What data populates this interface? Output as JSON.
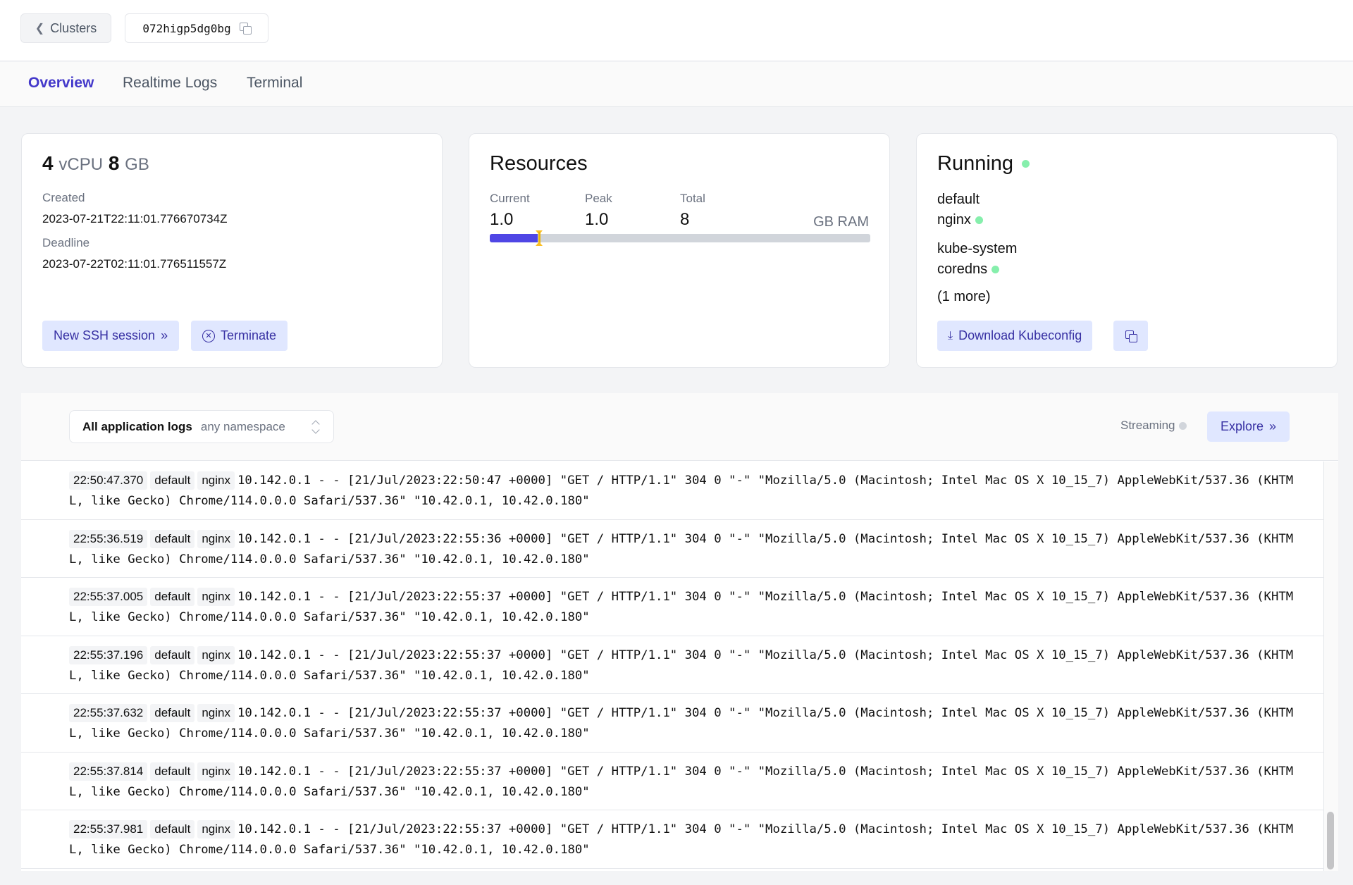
{
  "header": {
    "back_label": "Clusters",
    "cluster_id": "072higp5dg0bg"
  },
  "tabs": [
    {
      "label": "Overview",
      "active": true
    },
    {
      "label": "Realtime Logs",
      "active": false
    },
    {
      "label": "Terminal",
      "active": false
    }
  ],
  "specs_card": {
    "vcpu": "4",
    "vcpu_unit": "vCPU",
    "memory": "8",
    "memory_unit": "GB",
    "created_label": "Created",
    "created_value": "2023-07-21T22:11:01.776670734Z",
    "deadline_label": "Deadline",
    "deadline_value": "2023-07-22T02:11:01.776511557Z",
    "ssh_button": "New SSH session",
    "terminate_button": "Terminate"
  },
  "resources_card": {
    "title": "Resources",
    "current_label": "Current",
    "current_value": "1.0",
    "peak_label": "Peak",
    "peak_value": "1.0",
    "total_label": "Total",
    "total_value": "8",
    "unit": "GB RAM",
    "current_fraction": 0.125,
    "peak_fraction": 0.125,
    "fill_color": "#4f46e5",
    "peak_color": "#fbbf24"
  },
  "status_card": {
    "status": "Running",
    "status_color": "#86efac",
    "namespaces": [
      {
        "name": "default",
        "service": "nginx"
      },
      {
        "name": "kube-system",
        "service": "coredns"
      }
    ],
    "more_label": "(1 more)",
    "download_button": "Download Kubeconfig"
  },
  "logs": {
    "filter_main": "All application logs",
    "filter_sub": "any namespace",
    "streaming_label": "Streaming",
    "explore_button": "Explore",
    "scroll_position": 0.86,
    "entries": [
      {
        "time": "22:50:47.370",
        "namespace": "default",
        "pod": "nginx",
        "message": "10.142.0.1 - - [21/Jul/2023:22:50:47 +0000] \"GET / HTTP/1.1\" 304 0 \"-\" \"Mozilla/5.0 (Macintosh; Intel Mac OS X 10_15_7) AppleWebKit/537.36 (KHTML, like Gecko) Chrome/114.0.0.0 Safari/537.36\" \"10.42.0.1, 10.42.0.180\""
      },
      {
        "time": "22:55:36.519",
        "namespace": "default",
        "pod": "nginx",
        "message": "10.142.0.1 - - [21/Jul/2023:22:55:36 +0000] \"GET / HTTP/1.1\" 304 0 \"-\" \"Mozilla/5.0 (Macintosh; Intel Mac OS X 10_15_7) AppleWebKit/537.36 (KHTML, like Gecko) Chrome/114.0.0.0 Safari/537.36\" \"10.42.0.1, 10.42.0.180\""
      },
      {
        "time": "22:55:37.005",
        "namespace": "default",
        "pod": "nginx",
        "message": "10.142.0.1 - - [21/Jul/2023:22:55:37 +0000] \"GET / HTTP/1.1\" 304 0 \"-\" \"Mozilla/5.0 (Macintosh; Intel Mac OS X 10_15_7) AppleWebKit/537.36 (KHTML, like Gecko) Chrome/114.0.0.0 Safari/537.36\" \"10.42.0.1, 10.42.0.180\""
      },
      {
        "time": "22:55:37.196",
        "namespace": "default",
        "pod": "nginx",
        "message": "10.142.0.1 - - [21/Jul/2023:22:55:37 +0000] \"GET / HTTP/1.1\" 304 0 \"-\" \"Mozilla/5.0 (Macintosh; Intel Mac OS X 10_15_7) AppleWebKit/537.36 (KHTML, like Gecko) Chrome/114.0.0.0 Safari/537.36\" \"10.42.0.1, 10.42.0.180\""
      },
      {
        "time": "22:55:37.632",
        "namespace": "default",
        "pod": "nginx",
        "message": "10.142.0.1 - - [21/Jul/2023:22:55:37 +0000] \"GET / HTTP/1.1\" 304 0 \"-\" \"Mozilla/5.0 (Macintosh; Intel Mac OS X 10_15_7) AppleWebKit/537.36 (KHTML, like Gecko) Chrome/114.0.0.0 Safari/537.36\" \"10.42.0.1, 10.42.0.180\""
      },
      {
        "time": "22:55:37.814",
        "namespace": "default",
        "pod": "nginx",
        "message": "10.142.0.1 - - [21/Jul/2023:22:55:37 +0000] \"GET / HTTP/1.1\" 304 0 \"-\" \"Mozilla/5.0 (Macintosh; Intel Mac OS X 10_15_7) AppleWebKit/537.36 (KHTML, like Gecko) Chrome/114.0.0.0 Safari/537.36\" \"10.42.0.1, 10.42.0.180\""
      },
      {
        "time": "22:55:37.981",
        "namespace": "default",
        "pod": "nginx",
        "message": "10.142.0.1 - - [21/Jul/2023:22:55:37 +0000] \"GET / HTTP/1.1\" 304 0 \"-\" \"Mozilla/5.0 (Macintosh; Intel Mac OS X 10_15_7) AppleWebKit/537.36 (KHTML, like Gecko) Chrome/114.0.0.0 Safari/537.36\" \"10.42.0.1, 10.42.0.180\""
      }
    ]
  }
}
